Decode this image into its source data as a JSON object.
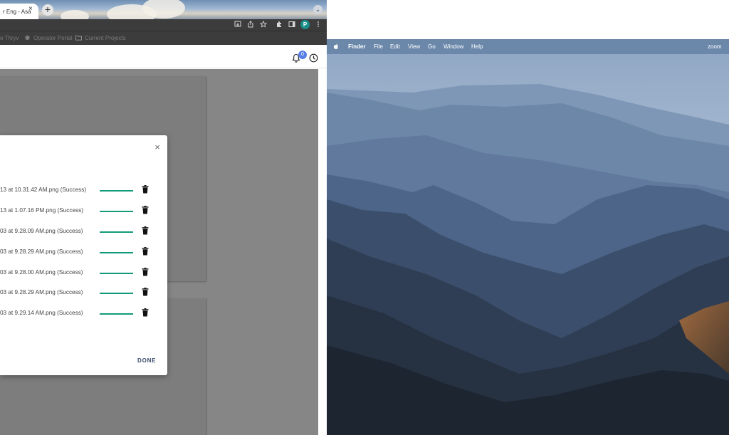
{
  "browser": {
    "tab_title": "r Eng - Asa",
    "tab_close": "×",
    "new_tab": "+",
    "tab_search": "⌄",
    "profile_initial": "P",
    "bookmarks": [
      {
        "label": "o Thryv"
      },
      {
        "label": "Operator Portal"
      },
      {
        "label": "Current Projects"
      }
    ]
  },
  "app": {
    "notification_count": "0"
  },
  "dialog": {
    "close": "×",
    "files": [
      {
        "name": "13 at 10.31.42 AM.png (Success)",
        "progress": 1.0
      },
      {
        "name": "13 at 1.07.16 PM.png (Success)",
        "progress": 1.0
      },
      {
        "name": "03 at 9.28.09 AM.png (Success)",
        "progress": 1.0
      },
      {
        "name": "03 at 9.28.29 AM.png (Success)",
        "progress": 1.0
      },
      {
        "name": "03 at 9.28.00 AM.png (Success)",
        "progress": 1.0
      },
      {
        "name": "03 at 9.28.29 AM.png (Success)",
        "progress": 1.0
      },
      {
        "name": "03 at 9.29.14 AM.png (Success)",
        "progress": 1.0
      }
    ],
    "done_label": "DONE",
    "success_color": "#139a7a"
  },
  "macos": {
    "menu": {
      "app_name": "Finder",
      "items": [
        "File",
        "Edit",
        "View",
        "Go",
        "Window",
        "Help"
      ],
      "status_app": "zoom"
    }
  }
}
